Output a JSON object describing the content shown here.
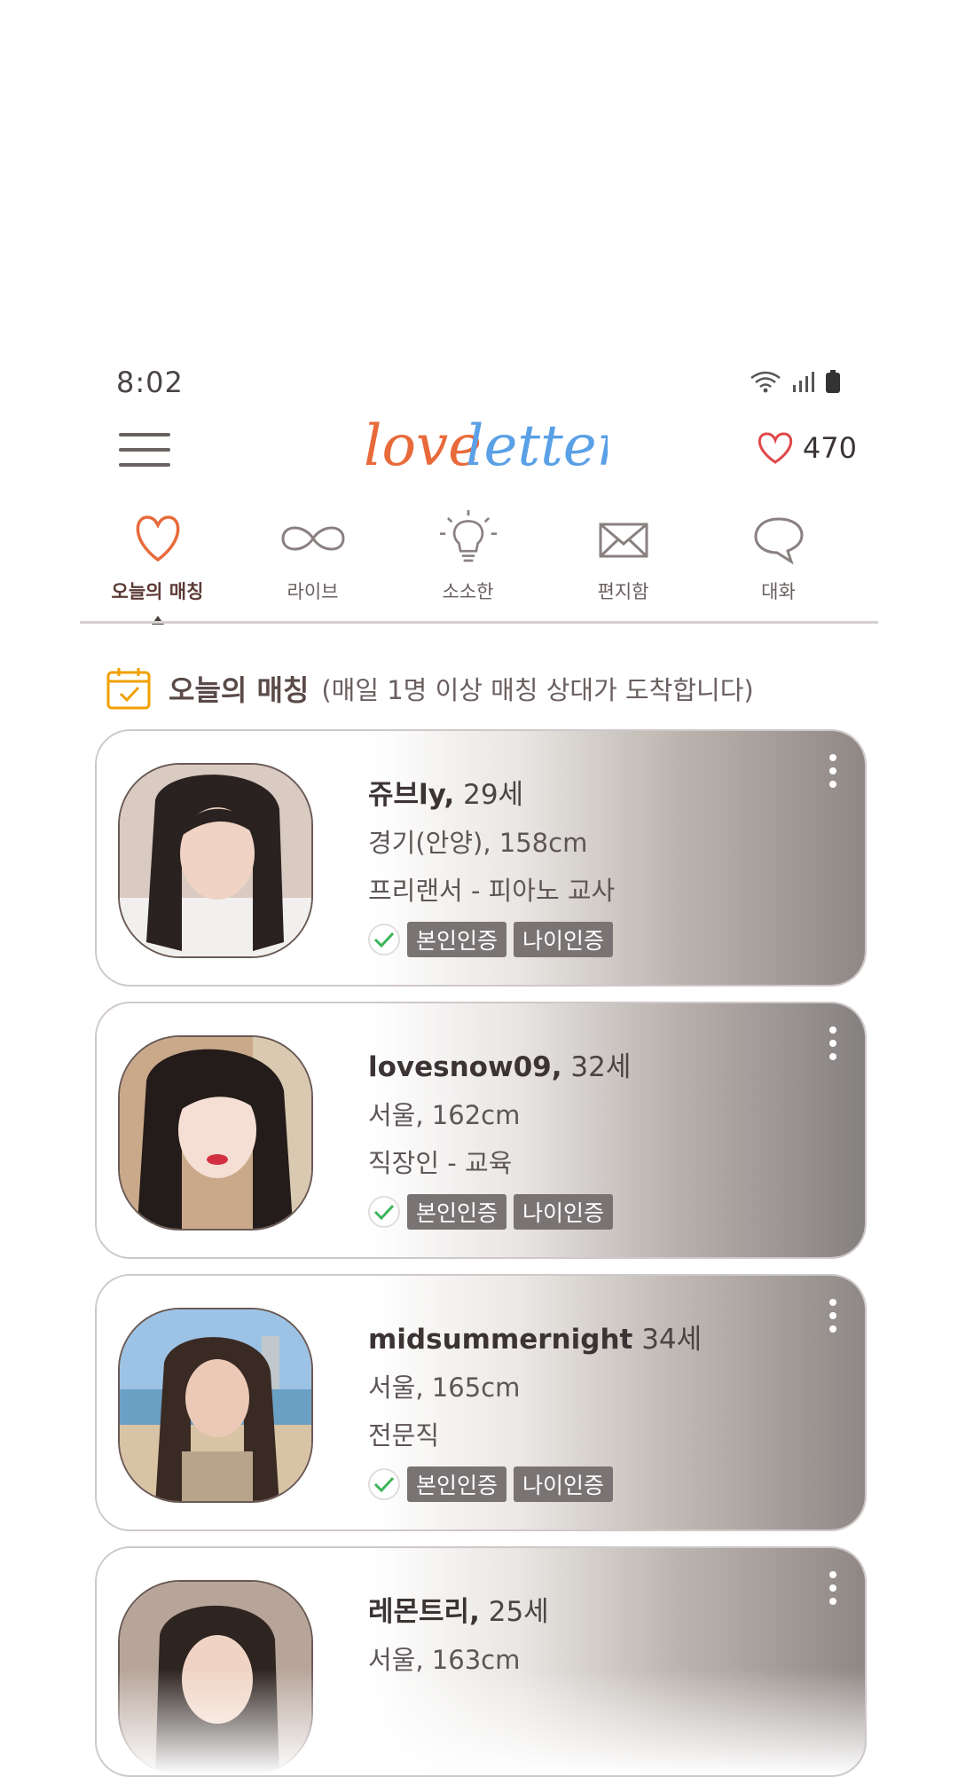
{
  "status": {
    "time": "8:02"
  },
  "header": {
    "logo": {
      "part1": "love",
      "part2": "letter"
    },
    "likes": "470"
  },
  "tabs": [
    {
      "label": "오늘의 매칭",
      "icon": "heart-icon",
      "active": true
    },
    {
      "label": "라이브",
      "icon": "infinity-icon",
      "active": false
    },
    {
      "label": "소소한",
      "icon": "lightbulb-icon",
      "active": false
    },
    {
      "label": "편지함",
      "icon": "envelope-icon",
      "active": false
    },
    {
      "label": "대화",
      "icon": "chat-bubble-icon",
      "active": false
    }
  ],
  "section": {
    "title": "오늘의 매칭",
    "subtitle": "(매일 1명 이상 매칭 상대가 도착합니다)"
  },
  "cards": [
    {
      "nick": "쥬브ly,",
      "age": "29세",
      "location": "경기(안양), 158cm",
      "job": "프리랜서 - 피아노 교사",
      "badges": [
        "본인인증",
        "나이인증"
      ]
    },
    {
      "nick": "lovesnow09,",
      "age": "32세",
      "location": "서울, 162cm",
      "job": "직장인 - 교육",
      "badges": [
        "본인인증",
        "나이인증"
      ]
    },
    {
      "nick": "midsummernight",
      "age": "34세",
      "location": "서울, 165cm",
      "job": "전문직",
      "badges": [
        "본인인증",
        "나이인증"
      ]
    },
    {
      "nick": "레몬트리,",
      "age": "25세",
      "location": "서울, 163cm",
      "job": "",
      "badges": []
    }
  ],
  "colors": {
    "accent": "#e86a3a",
    "logoBlue": "#5aa0e6",
    "heart": "#e0484a",
    "badge": "#7a7373"
  }
}
